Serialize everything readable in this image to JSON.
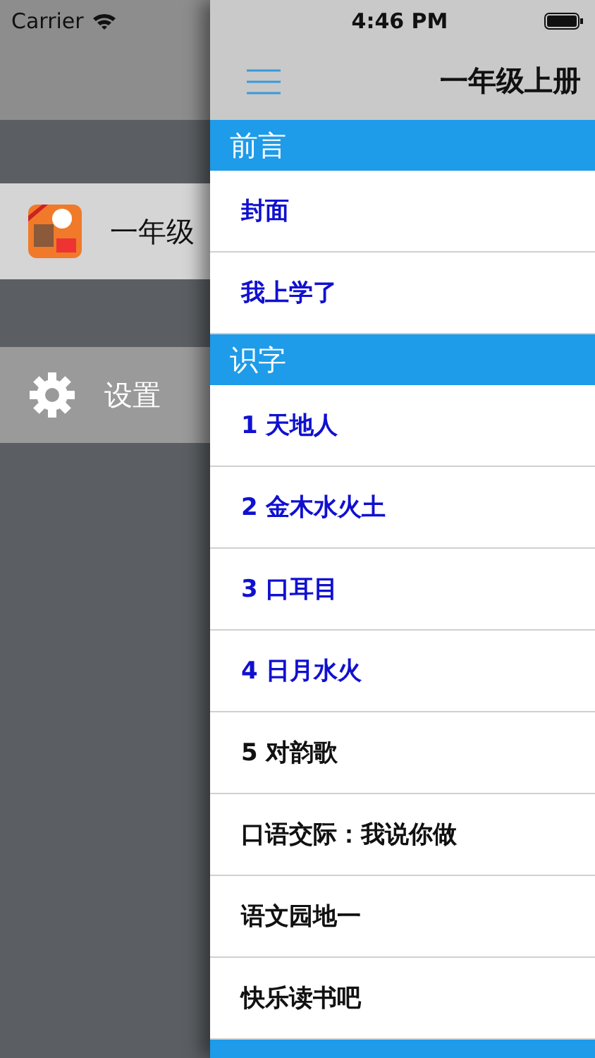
{
  "status_bar": {
    "carrier": "Carrier",
    "time": "4:46 PM"
  },
  "drawer": {
    "items": [
      {
        "kind": "book",
        "label": "一年级",
        "selected": true
      },
      {
        "kind": "settings",
        "label": "设置",
        "selected": false
      }
    ]
  },
  "nav": {
    "title": "一年级上册"
  },
  "sections": [
    {
      "title": "前言",
      "rows": [
        {
          "label": "封面",
          "color": "#1010d0"
        },
        {
          "label": "我上学了",
          "color": "#1010d0"
        }
      ]
    },
    {
      "title": "识字",
      "rows": [
        {
          "label": "1 天地人",
          "color": "#1010d0"
        },
        {
          "label": "2 金木水火土",
          "color": "#1010d0"
        },
        {
          "label": "3 口耳目",
          "color": "#1010d0"
        },
        {
          "label": "4 日月水火",
          "color": "#1010d0"
        },
        {
          "label": "5 对韵歌",
          "color": "#111111"
        },
        {
          "label": "口语交际：我说你做",
          "color": "#111111"
        },
        {
          "label": "语文园地一",
          "color": "#111111"
        },
        {
          "label": "快乐读书吧",
          "color": "#111111"
        }
      ]
    }
  ]
}
